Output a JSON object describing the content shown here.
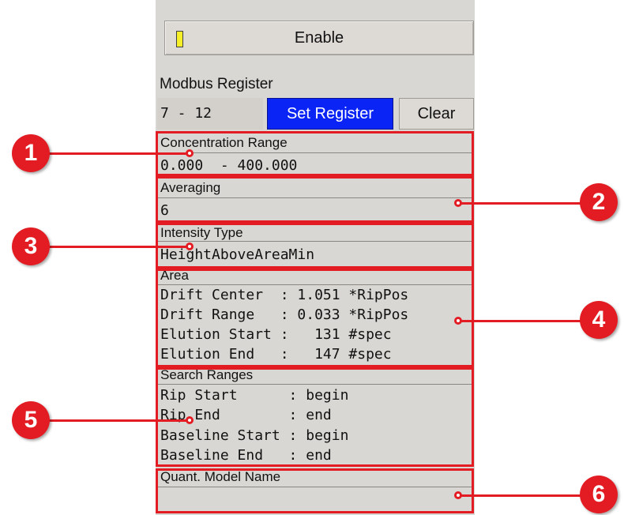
{
  "enable": {
    "label": "Enable",
    "led_color": "#f7ef2a"
  },
  "modbus": {
    "label": "Modbus Register",
    "value": "7 - 12",
    "set_label": "Set Register",
    "clear_label": "Clear"
  },
  "sections": {
    "concentration": {
      "title": "Concentration Range",
      "value": "0.000  - 400.000"
    },
    "averaging": {
      "title": "Averaging",
      "value": "6"
    },
    "intensity": {
      "title": "Intensity Type",
      "value": "HeightAboveAreaMin"
    },
    "area": {
      "title": "Area",
      "lines": [
        "Drift Center  : 1.051 *RipPos",
        "Drift Range   : 0.033 *RipPos",
        "Elution Start :   131 #spec",
        "Elution End   :   147 #spec"
      ]
    },
    "search": {
      "title": "Search Ranges",
      "lines": [
        "Rip Start      : begin",
        "Rip End        : end",
        "Baseline Start : begin",
        "Baseline End   : end"
      ]
    },
    "model": {
      "title": "Quant. Model Name",
      "value": ""
    }
  },
  "callouts": [
    "1",
    "2",
    "3",
    "4",
    "5",
    "6"
  ],
  "colors": {
    "annotation_red": "#e31c23",
    "accent_blue": "#0a24f5",
    "panel_bg": "#d9d7d3"
  }
}
